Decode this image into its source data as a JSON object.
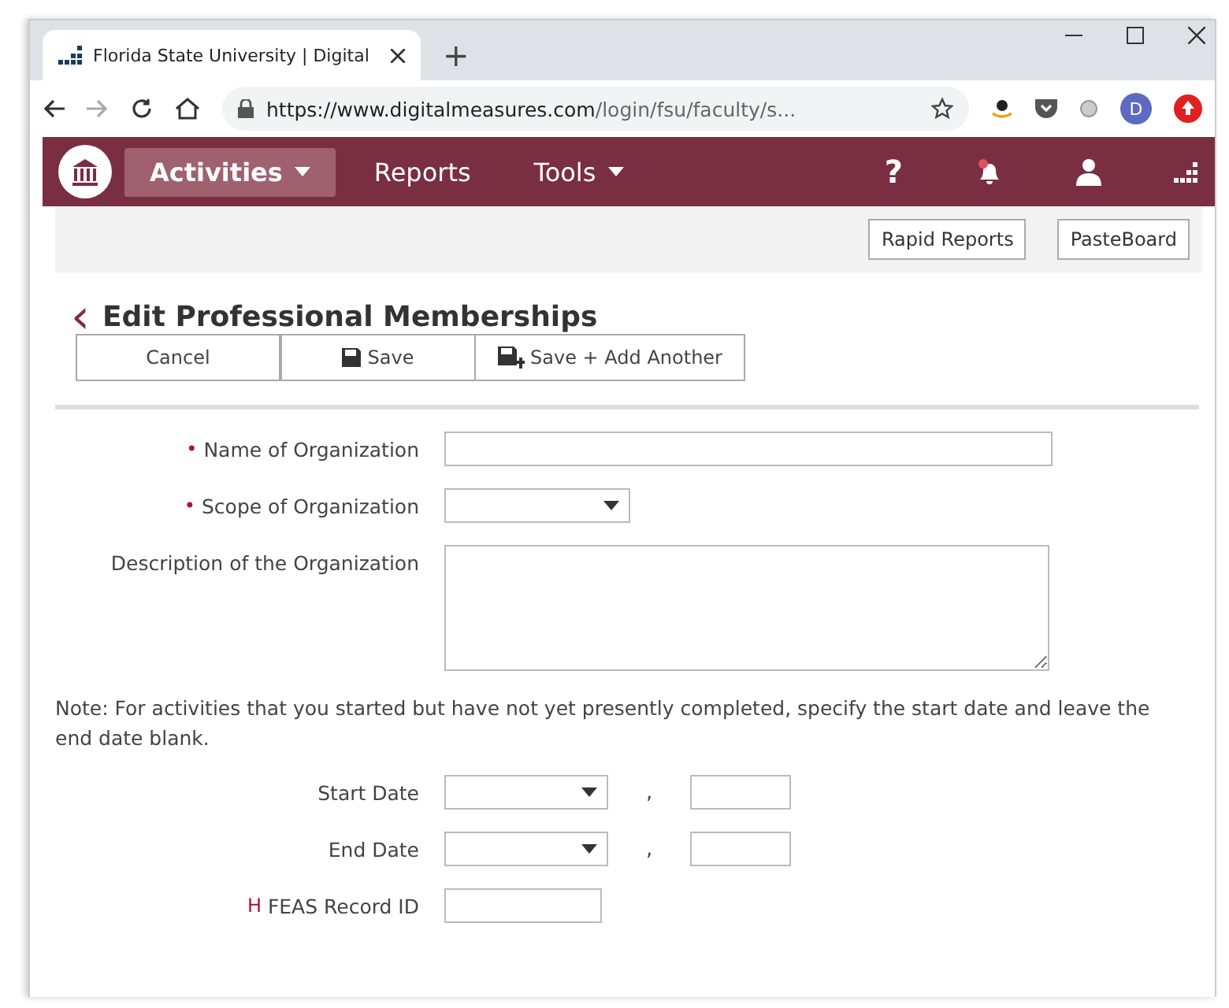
{
  "browser": {
    "tab_title": "Florida State University | Digital",
    "new_tab": "+",
    "url_host": "https://www.digitalmeasures.com",
    "url_path": "/login/fsu/faculty/s...",
    "profile_initial": "D"
  },
  "nav": {
    "items": [
      {
        "label": "Activities",
        "dropdown": true,
        "selected": true
      },
      {
        "label": "Reports",
        "dropdown": false,
        "selected": false
      },
      {
        "label": "Tools",
        "dropdown": true,
        "selected": false
      }
    ],
    "help": "?"
  },
  "toolbar": {
    "buttons": [
      "Rapid Reports",
      "PasteBoard"
    ]
  },
  "page": {
    "back": "‹",
    "title": "Edit Professional Memberships"
  },
  "actions": [
    {
      "label": "Cancel",
      "kind": "plain"
    },
    {
      "label": "Save",
      "kind": "save"
    },
    {
      "label": "Save + Add Another",
      "kind": "save-add"
    }
  ],
  "fields": [
    {
      "kind": "text",
      "label": "Name of Organization",
      "marker": "•"
    },
    {
      "kind": "select",
      "label": "Scope of Organization",
      "marker": "•"
    },
    {
      "kind": "textarea",
      "label": "Description of the Organization"
    },
    {
      "kind": "note",
      "label": "Note: For activities that you started but have not yet presently completed, specify the start date and leave the end date blank."
    },
    {
      "kind": "date",
      "label": "Start Date",
      "separator": ","
    },
    {
      "kind": "date",
      "label": "End Date",
      "separator": ","
    },
    {
      "kind": "short",
      "label": "FEAS Record ID",
      "marker": "H"
    }
  ]
}
